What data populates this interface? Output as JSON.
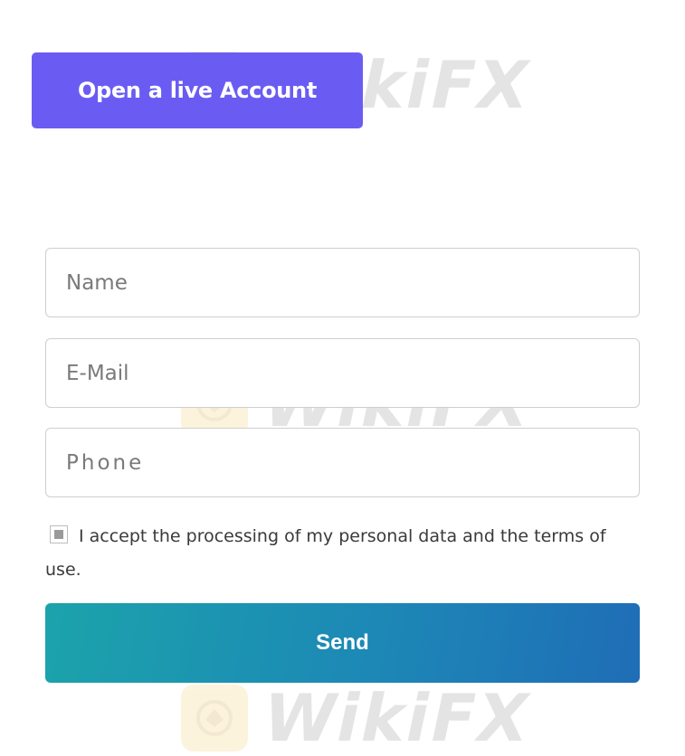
{
  "watermark": {
    "text": "WikiFX",
    "icon": "wikifx-eagle-logo"
  },
  "cta": {
    "label": "Open a live Account"
  },
  "form": {
    "name_placeholder": "Name",
    "email_placeholder": "E-Mail",
    "phone_placeholder": "Phone",
    "consent_text": "I accept the processing of my personal data and the terms of use.",
    "consent_checked": true,
    "send_label": "Send"
  },
  "colors": {
    "cta_background": "#6a5cf3",
    "send_gradient_start": "#1ba3ab",
    "send_gradient_end": "#1f6db6",
    "field_border": "#cfcfcf"
  }
}
